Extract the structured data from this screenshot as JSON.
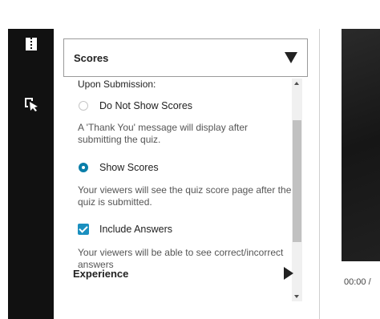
{
  "rail": {
    "icons": [
      "split-view-icon",
      "cursor-select-icon"
    ]
  },
  "panel": {
    "scores_section": {
      "title": "Scores",
      "subheading": "Upon Submission:",
      "options": [
        {
          "label": "Do Not Show Scores",
          "selected": false,
          "description": "A 'Thank You' message will display after submitting the quiz."
        },
        {
          "label": "Show Scores",
          "selected": true,
          "description": "Your viewers will see the quiz score page after the quiz is submitted."
        }
      ],
      "include_answers": {
        "label": "Include Answers",
        "checked": true,
        "description": "Your viewers will be able to see correct/incorrect answers"
      }
    },
    "experience_section": {
      "title": "Experience"
    }
  },
  "video": {
    "time": "00:00 /"
  },
  "colors": {
    "accent": "#1a8fbf",
    "rail": "#111111"
  }
}
